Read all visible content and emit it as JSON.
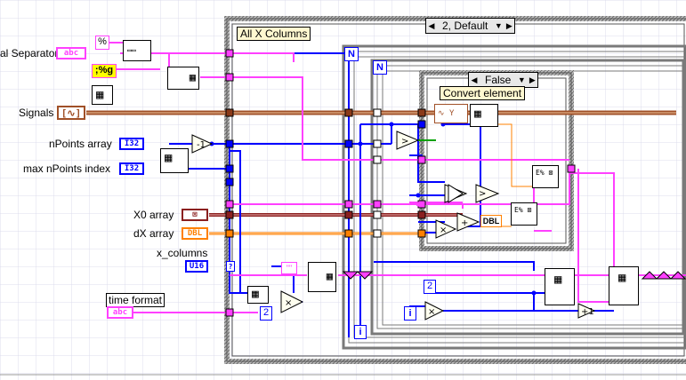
{
  "controls": {
    "separator_label": "al Separator",
    "signals_label": "Signals",
    "npoints_array_label": "nPoints array",
    "max_npoints_index_label": "max nPoints index",
    "x0_array_label": "X0 array",
    "dx_array_label": "dX array",
    "x_columns_label": "x_columns",
    "time_format_label": "time format"
  },
  "terminals": {
    "separator_type": "abc",
    "npoints_type": "I32",
    "max_index_type": "I32",
    "x0_type": "⊠",
    "dx_type": "DBL",
    "x_columns_type": "U16",
    "time_format_type": "abc"
  },
  "constants": {
    "percent": "%",
    "format_g": ";%g",
    "two_a": "2",
    "two_b": "2",
    "empty_string": "\"\"",
    "dbl_a": "DBL",
    "dbl_b": "DBL"
  },
  "structures": {
    "outer_case_selector": "2, Default",
    "outer_frame_title": "All X Columns",
    "inner_case_selector": "False",
    "inner_frame_title": "Convert element",
    "loop_n1": "N",
    "loop_n2": "N",
    "loop_i1": "i",
    "loop_i2": "i"
  },
  "colors": {
    "string_wire": "#ff40ff",
    "int_wire": "#0000ff",
    "dbl_wire": "#ff8000",
    "waveform_wire": "#a05028",
    "structure_frame": "#808080",
    "grid": "#d8d8f0"
  }
}
